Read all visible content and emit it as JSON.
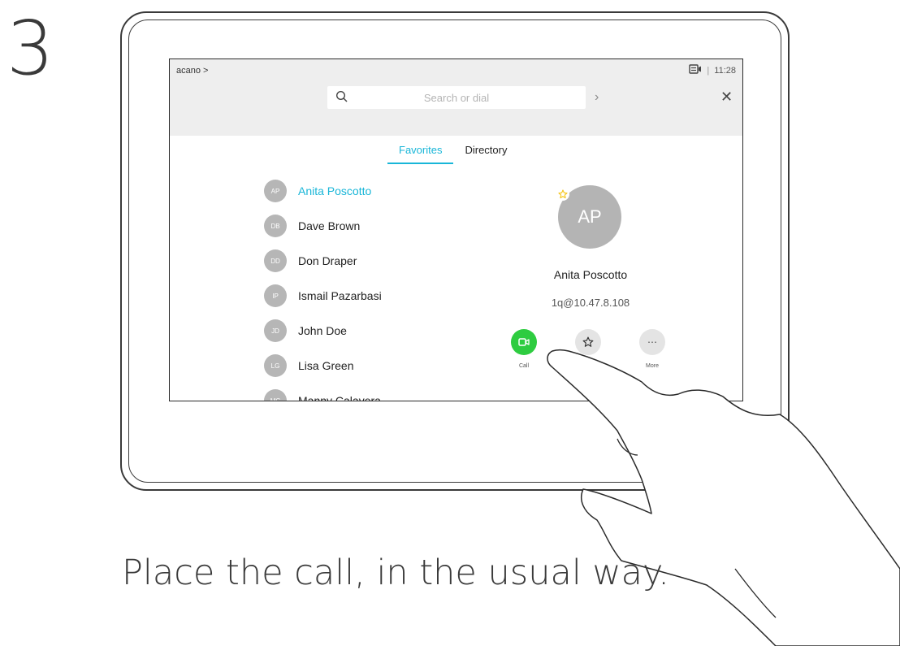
{
  "step_number": "3",
  "caption": "Place the call, in the usual way.",
  "device": {
    "topbar": {
      "brand": "acano >",
      "time": "11:28",
      "search_placeholder": "Search or dial"
    },
    "tabs": [
      {
        "label": "Favorites",
        "active": true
      },
      {
        "label": "Directory",
        "active": false
      }
    ],
    "contacts": [
      {
        "initials": "AP",
        "name": "Anita Poscotto",
        "selected": true
      },
      {
        "initials": "DB",
        "name": "Dave Brown"
      },
      {
        "initials": "DD",
        "name": "Don Draper"
      },
      {
        "initials": "IP",
        "name": "Ismail Pazarbasi"
      },
      {
        "initials": "JD",
        "name": "John Doe"
      },
      {
        "initials": "LG",
        "name": "Lisa Green"
      },
      {
        "initials": "MC",
        "name": "Manny Calavera"
      }
    ],
    "detail": {
      "initials": "AP",
      "name": "Anita Poscotto",
      "address": "1q@10.47.8.108"
    },
    "actions": [
      {
        "label": "Call",
        "icon": "video-camera-icon"
      },
      {
        "label": "",
        "icon": "star-icon"
      },
      {
        "label": "More",
        "icon": "ellipsis-icon"
      }
    ]
  },
  "colors": {
    "accent": "#19b6d8",
    "call": "#2ecc40",
    "avatar": "#b6b6b6",
    "favorite_star": "#f5c518"
  }
}
